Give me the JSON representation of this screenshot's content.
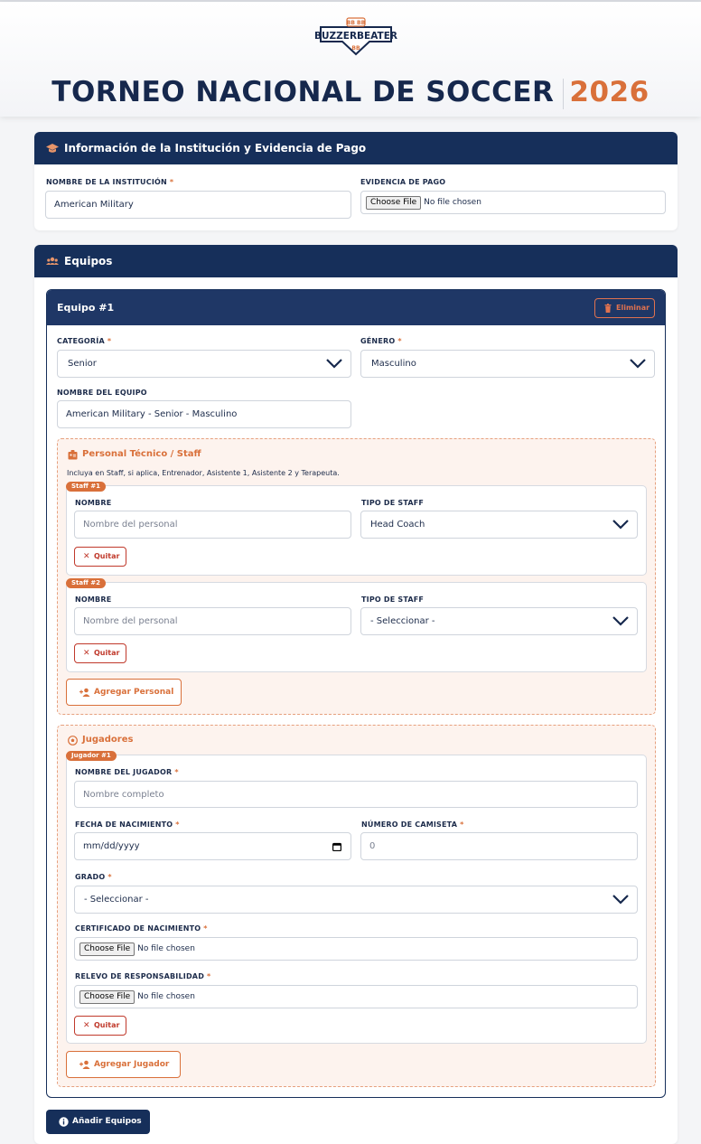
{
  "header": {
    "logo_text": "BUZZERBEATER",
    "logo_top_text": "BB BB",
    "logo_bottom_text": "BB",
    "title": "TORNEO NACIONAL DE SOCCER",
    "year": "2026"
  },
  "institution": {
    "section_title": "Información de la Institución y Evidencia de Pago",
    "name_label": "NOMBRE DE LA INSTITUCIÓN",
    "name_value": "American Military",
    "payment_label": "EVIDENCIA DE PAGO",
    "payment_button": "Choose File",
    "payment_status": "No file chosen"
  },
  "teams": {
    "section_title": "Equipos",
    "team": {
      "title": "Equipo #1",
      "delete_label": "Eliminar",
      "category_label": "CATEGORÍA",
      "category_value": "Senior",
      "gender_label": "GÉNERO",
      "gender_value": "Masculino",
      "team_name_label": "NOMBRE DEL EQUIPO",
      "team_name_value": "American Military - Senior - Masculino",
      "staff": {
        "title": "Personal Técnico / Staff",
        "note": "Incluya en Staff, si aplica, Entrenador, Asistente 1, Asistente 2 y Terapeuta.",
        "items": [
          {
            "badge": "Staff #1",
            "name_label": "NOMBRE",
            "name_placeholder": "Nombre del personal",
            "type_label": "TIPO DE STAFF",
            "type_value": "Head Coach",
            "remove_label": "Quitar"
          },
          {
            "badge": "Staff #2",
            "name_label": "NOMBRE",
            "name_placeholder": "Nombre del personal",
            "type_label": "TIPO DE STAFF",
            "type_value": "- Seleccionar -",
            "remove_label": "Quitar"
          }
        ],
        "add_label": "Agregar Personal"
      },
      "players": {
        "title": "Jugadores",
        "items": [
          {
            "badge": "Jugador #1",
            "name_label": "NOMBRE DEL JUGADOR",
            "name_placeholder": "Nombre completo",
            "birth_label": "FECHA DE NACIMIENTO",
            "birth_placeholder": "mm/dd/yyyy",
            "shirt_label": "NÚMERO DE CAMISETA",
            "shirt_placeholder": "0",
            "grade_label": "GRADO",
            "grade_value": "- Seleccionar -",
            "cert_label": "CERTIFICADO DE NACIMIENTO",
            "cert_button": "Choose File",
            "cert_status": "No file chosen",
            "waiver_label": "RELEVO DE RESPONSABILIDAD",
            "waiver_button": "Choose File",
            "waiver_status": "No file chosen",
            "remove_label": "Quitar"
          }
        ],
        "add_label": "Agregar Jugador"
      }
    },
    "add_teams_label": "Añadir Equipos"
  },
  "required_mark": "*",
  "colors": {
    "navy": "#162f5a",
    "accent": "#d9703a",
    "danger": "#c0392b"
  },
  "icons": [
    "graduation-cap-icon",
    "users-icon",
    "trash-icon",
    "id-badge-icon",
    "user-plus-icon",
    "soccer-ball-icon",
    "info-icon",
    "chevron-down-icon",
    "calendar-icon",
    "close-icon"
  ]
}
